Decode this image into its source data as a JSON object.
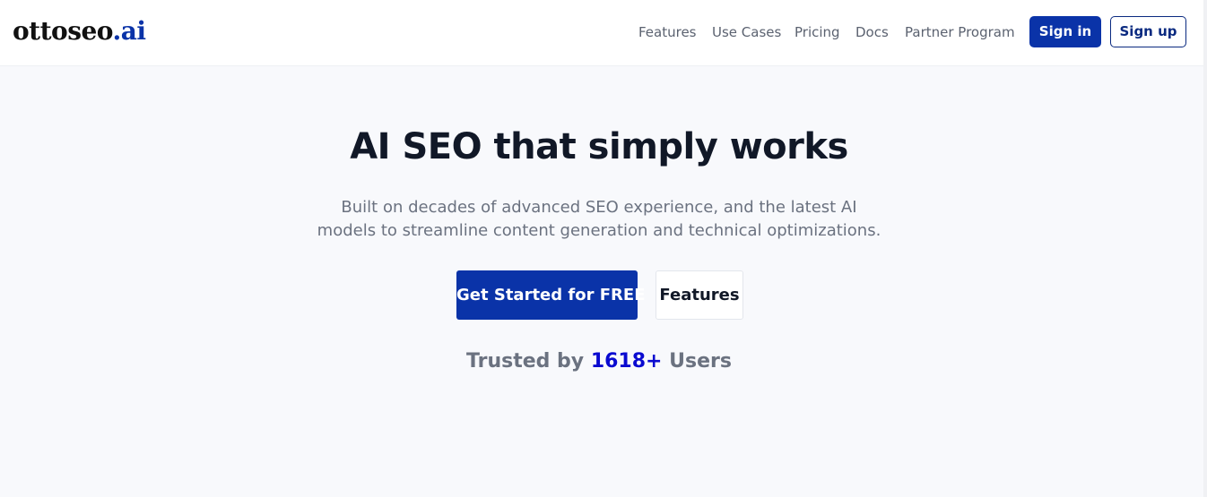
{
  "header": {
    "logo": {
      "name": "ottoseo",
      "suffix": ".ai",
      "accent_color": "#0a33a8"
    },
    "nav": [
      "Features",
      "Use Cases",
      "Pricing",
      "Docs",
      "Partner Program"
    ],
    "signin_label": "Sign in",
    "signup_label": "Sign up"
  },
  "hero": {
    "title": "AI SEO that simply works",
    "subtitle_line1": "Built on decades of advanced SEO experience, and the latest AI",
    "subtitle_line2": "models to streamline content generation and technical optimizations.",
    "cta_primary": "Get Started for FREE",
    "cta_secondary": "Features",
    "trusted": {
      "prefix": "Trusted by",
      "count": "1618+",
      "suffix": "Users",
      "count_color": "#0a0ad0"
    }
  },
  "colors": {
    "brand": "#0a33a8",
    "page_background": "#f8f9fc",
    "header_background": "#ffffff"
  }
}
